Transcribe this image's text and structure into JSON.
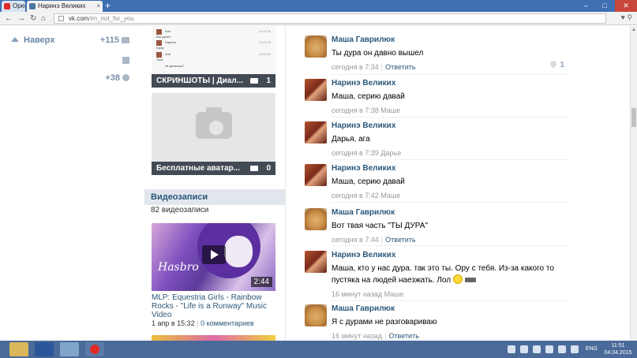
{
  "browser": {
    "tabs": [
      {
        "label": "Opera",
        "favicon_color": "#e02b26"
      },
      {
        "label": "Наринэ Великих",
        "favicon_color": "#4c75a3"
      }
    ],
    "new_tab": "+",
    "url_host": "vk.com",
    "url_path": "/im_not_for_you"
  },
  "left_nav": {
    "up_label": "Наверх",
    "counter_messages": "+115",
    "counter_settings": "+38"
  },
  "sidebar": {
    "screenshots": {
      "caption": "СКРИНШОТЫ | Диал...",
      "count": "1",
      "mini_rows": [
        {
          "name": "Аня",
          "text": "Как дела?",
          "time": "14:23:26"
        },
        {
          "name": "Наринэ",
          "text": "норм",
          "time": "14:23:28"
        },
        {
          "name": "Аня",
          "text": "Тоха",
          "time": "14:23:33"
        },
        {
          "name": "",
          "text": "чё делаешь?",
          "time": ""
        }
      ]
    },
    "avatars": {
      "caption": "Бесплатные аватар...",
      "count": "0"
    },
    "videos": {
      "header": "Видеозаписи",
      "count_label": "82 видеозаписи",
      "thumb_logo": "Hasbro",
      "duration": "2:44",
      "title": "MLP: Equestria Girls - Rainbow Rocks - \"Life is a Runway\" Music Video",
      "date": "1 апр в 15:32",
      "comments": "0 комментариев"
    }
  },
  "messages": [
    {
      "author": "Маша Гаврилюк",
      "avatar": "dog",
      "text": "Ты дура он давно вышел",
      "time": "сегодня в 7:34",
      "reply": "Ответить",
      "likes": "1"
    },
    {
      "author": "Наринэ Великих",
      "avatar": "girl",
      "text": "Маша, серию давай",
      "time": "сегодня в 7:38",
      "reply_to": "Маше"
    },
    {
      "author": "Наринэ Великих",
      "avatar": "girl",
      "text": "Дарья, ага",
      "time": "сегодня в 7:39",
      "reply_to": "Дарье"
    },
    {
      "author": "Наринэ Великих",
      "avatar": "girl",
      "text": "Маша, серию давай",
      "time": "сегодня в 7:42",
      "reply_to": "Маше"
    },
    {
      "author": "Маша Гаврилюк",
      "avatar": "dog",
      "text": "Вот твая часть \"ТЫ ДУРА\"",
      "time": "сегодня в 7:44",
      "reply": "Ответить"
    },
    {
      "author": "Наринэ Великих",
      "avatar": "girl",
      "text": "Маша, кто у нас дура. так это ты. Ору с тебя. Из-за какого то пустяка на людей наезжать. Лол",
      "time": "16 минут назад",
      "reply_to": "Маше"
    },
    {
      "author": "Маша Гаврилюк",
      "avatar": "dog",
      "text": "Я с дурами не разговариваю",
      "time": "16 минут назад",
      "reply": "Ответить"
    }
  ],
  "taskbar": {
    "lang": "ENG",
    "time": "11:51",
    "date": "04.04.2015"
  }
}
